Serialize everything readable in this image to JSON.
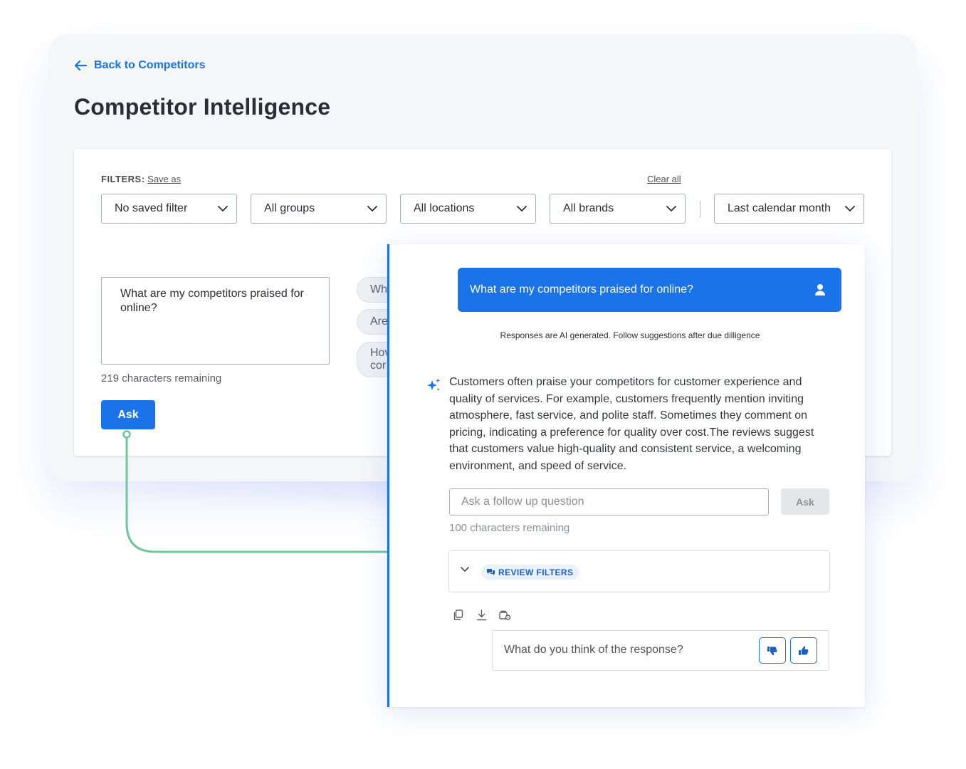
{
  "header": {
    "back_label": "Back to Competitors",
    "title": "Competitor Intelligence"
  },
  "filters": {
    "label": "FILTERS:",
    "save_as": "Save as",
    "clear_all": "Clear all",
    "selects": [
      {
        "value": "No saved filter"
      },
      {
        "value": "All groups"
      },
      {
        "value": "All locations"
      },
      {
        "value": "All brands"
      },
      {
        "value": "Last calendar month"
      }
    ]
  },
  "query": {
    "text": "What are my competitors praised for online?",
    "chars_remaining": "219 characters remaining",
    "ask_label": "Ask"
  },
  "suggestions": [
    {
      "label": "Wh"
    },
    {
      "label": "Are"
    },
    {
      "line1": "Hov",
      "line2": "cor"
    }
  ],
  "chat": {
    "user_message": "What are my competitors praised for online?",
    "disclaimer": "Responses are AI generated. Follow suggestions after due dilligence",
    "answer": "Customers often praise your competitors for customer experience and quality of services. For example, customers frequently mention inviting atmosphere, fast service, and polite staff. Sometimes they comment on pricing, indicating a preference for quality over cost.The reviews suggest that customers value high-quality and consistent service, a welcoming environment, and speed of service.",
    "followup_placeholder": "Ask a follow up question",
    "followup_ask_label": "Ask",
    "followup_chars_remaining": "100 characters remaining",
    "review_filters_label": "REVIEW FILTERS",
    "feedback_prompt": "What do you think of the response?"
  },
  "colors": {
    "accent": "#1a73e8",
    "connector": "#6cc79a"
  },
  "icons": [
    "arrow-left-icon",
    "chevron-down-icon",
    "user-icon",
    "sparkle-icon",
    "chat-bubbles-icon",
    "copy-icon",
    "download-icon",
    "settings-icon",
    "thumbs-down-icon",
    "thumbs-up-icon"
  ]
}
